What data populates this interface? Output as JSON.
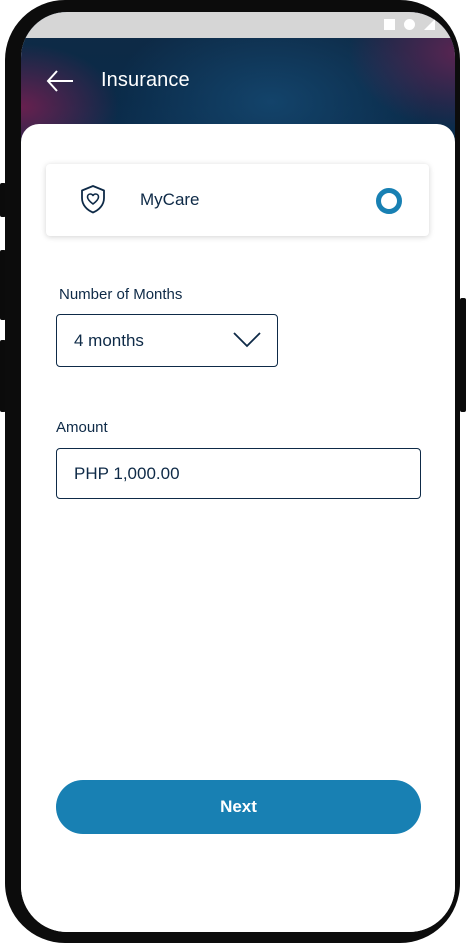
{
  "app_bar": {
    "title": "Insurance",
    "back_icon": "arrow-left-icon"
  },
  "status_bar": {
    "icons": [
      "square-icon",
      "circle-icon",
      "triangle-icon"
    ]
  },
  "product": {
    "name": "MyCare",
    "icon": "shield-heart-icon",
    "selected": true
  },
  "months": {
    "label": "Number of Months",
    "value": "4 months"
  },
  "amount": {
    "label": "Amount",
    "value": "PHP 1,000.00"
  },
  "actions": {
    "next_label": "Next"
  },
  "colors": {
    "primary": "#1880b3",
    "text": "#0e2a47",
    "header": "#0a2a48"
  }
}
